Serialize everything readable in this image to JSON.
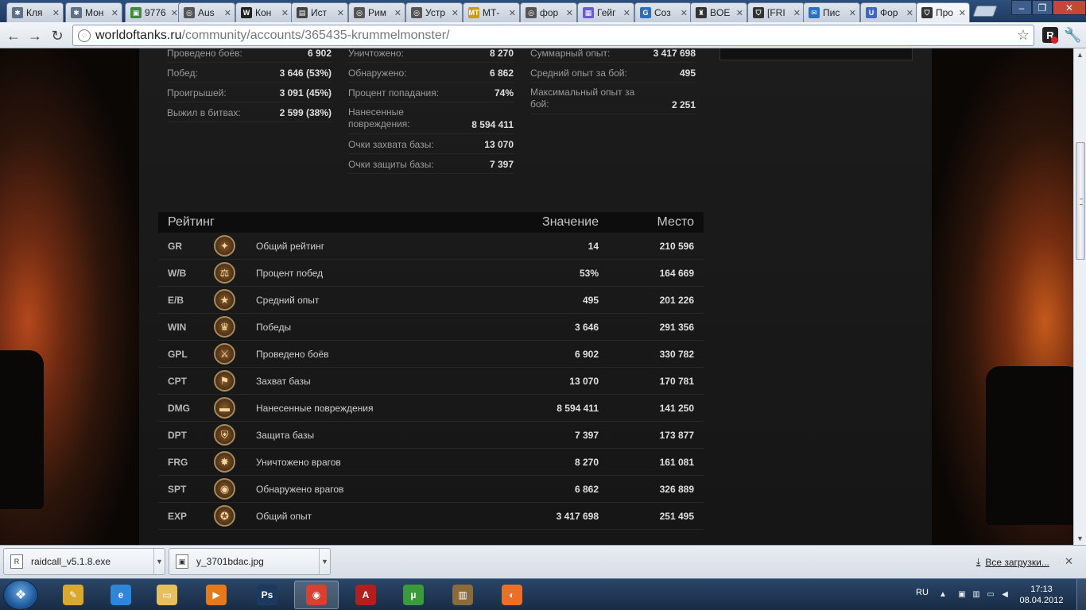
{
  "browser": {
    "tabs": [
      {
        "title": "Кля",
        "favicon": "puzzle-icon",
        "color": "#5f6f86",
        "glyph": "✱"
      },
      {
        "title": "Мон",
        "favicon": "puzzle-icon",
        "color": "#5f6f86",
        "glyph": "✱"
      },
      {
        "title": "9776",
        "favicon": "image-icon",
        "color": "#3e8a3e",
        "glyph": "▣"
      },
      {
        "title": "Aus",
        "favicon": "globe-icon",
        "color": "#555",
        "glyph": "◎"
      },
      {
        "title": "Кон",
        "favicon": "wikipedia-icon",
        "color": "#222",
        "glyph": "W"
      },
      {
        "title": "Ист",
        "favicon": "page-icon",
        "color": "#444",
        "glyph": "▤"
      },
      {
        "title": "Рим",
        "favicon": "globe-icon",
        "color": "#555",
        "glyph": "◎"
      },
      {
        "title": "Устр",
        "favicon": "globe-icon",
        "color": "#555",
        "glyph": "◎"
      },
      {
        "title": "МТ-",
        "favicon": "mt-icon",
        "color": "#c89b12",
        "glyph": "MT"
      },
      {
        "title": "фор",
        "favicon": "globe-icon",
        "color": "#555",
        "glyph": "◎"
      },
      {
        "title": "Гейг",
        "favicon": "calendar-icon",
        "color": "#6b5bd0",
        "glyph": "▦"
      },
      {
        "title": "Соз",
        "favicon": "blog-icon",
        "color": "#2a6fc4",
        "glyph": "G"
      },
      {
        "title": "BOE",
        "favicon": "tank-icon",
        "color": "#333",
        "glyph": "♜"
      },
      {
        "title": "[FRI",
        "favicon": "shield-icon",
        "color": "#333",
        "glyph": "⛉"
      },
      {
        "title": "Пис",
        "favicon": "mail-icon",
        "color": "#2a6fc4",
        "glyph": "✉"
      },
      {
        "title": "Фор",
        "favicon": "u-icon",
        "color": "#3f66c0",
        "glyph": "U"
      },
      {
        "title": "Про",
        "favicon": "wot-icon",
        "color": "#333",
        "glyph": "⛉",
        "active": true
      }
    ],
    "url_domain": "worldoftanks.ru",
    "url_path": "/community/accounts/365435-krummelmonster/",
    "window_buttons": {
      "minimize": "–",
      "maximize": "❐",
      "close": "✕"
    }
  },
  "stats": {
    "col1": [
      {
        "label": "Проведено боёв:",
        "value": "6 902"
      },
      {
        "label": "Побед:",
        "value": "3 646 (53%)"
      },
      {
        "label": "Проигрышей:",
        "value": "3 091 (45%)"
      },
      {
        "label": "Выжил в битвах:",
        "value": "2 599 (38%)"
      }
    ],
    "col2": [
      {
        "label": "Уничтожено:",
        "value": "8 270"
      },
      {
        "label": "Обнаружено:",
        "value": "6 862"
      },
      {
        "label": "Процент попадания:",
        "value": "74%"
      },
      {
        "label": "Нанесенные повреждения:",
        "value": "8 594 411"
      },
      {
        "label": "Очки захвата базы:",
        "value": "13 070"
      },
      {
        "label": "Очки защиты базы:",
        "value": "7 397"
      }
    ],
    "col3": [
      {
        "label": "Суммарный опыт:",
        "value": "3 417 698"
      },
      {
        "label": "Средний опыт за бой:",
        "value": "495"
      },
      {
        "label": "Максимальный опыт за бой:",
        "value": "2 251"
      }
    ]
  },
  "rating": {
    "header": {
      "title": "Рейтинг",
      "value": "Значение",
      "place": "Место"
    },
    "rows": [
      {
        "code": "GR",
        "icon": "eagle-icon",
        "glyph": "✦",
        "name": "Общий рейтинг",
        "value": "14",
        "place": "210 596"
      },
      {
        "code": "W/B",
        "icon": "scales-icon",
        "glyph": "⚖",
        "name": "Процент побед",
        "value": "53%",
        "place": "164 669"
      },
      {
        "code": "E/B",
        "icon": "star-icon",
        "glyph": "★",
        "name": "Средний опыт",
        "value": "495",
        "place": "201 226"
      },
      {
        "code": "WIN",
        "icon": "trophy-icon",
        "glyph": "♛",
        "name": "Победы",
        "value": "3 646",
        "place": "291 356"
      },
      {
        "code": "GPL",
        "icon": "crossed-swords-icon",
        "glyph": "⚔",
        "name": "Проведено боёв",
        "value": "6 902",
        "place": "330 782"
      },
      {
        "code": "CPT",
        "icon": "flag-icon",
        "glyph": "⚑",
        "name": "Захват базы",
        "value": "13 070",
        "place": "170 781"
      },
      {
        "code": "DMG",
        "icon": "tank-icon",
        "glyph": "▬",
        "name": "Нанесенные повреждения",
        "value": "8 594 411",
        "place": "141 250"
      },
      {
        "code": "DPT",
        "icon": "shield-icon",
        "glyph": "⛨",
        "name": "Защита базы",
        "value": "7 397",
        "place": "173 877"
      },
      {
        "code": "FRG",
        "icon": "explosion-icon",
        "glyph": "✸",
        "name": "Уничтожено врагов",
        "value": "8 270",
        "place": "161 081"
      },
      {
        "code": "SPT",
        "icon": "binoculars-icon",
        "glyph": "◉",
        "name": "Обнаружено врагов",
        "value": "6 862",
        "place": "326 889"
      },
      {
        "code": "EXP",
        "icon": "star-icon",
        "glyph": "✪",
        "name": "Общий опыт",
        "value": "3 417 698",
        "place": "251 495"
      }
    ]
  },
  "downloads": {
    "items": [
      {
        "name": "raidcall_v5.1.8.exe",
        "icon": "exe-file-icon",
        "glyph": "R"
      },
      {
        "name": "y_3701bdac.jpg",
        "icon": "image-file-icon",
        "glyph": "▣"
      }
    ],
    "show_all": "Все загрузки...",
    "close": "✕"
  },
  "taskbar": {
    "items": [
      {
        "name": "paint-icon",
        "glyph": "✎",
        "color": "#d9a82f"
      },
      {
        "name": "internet-explorer-icon",
        "glyph": "e",
        "color": "#2f86d6"
      },
      {
        "name": "folder-icon",
        "glyph": "▭",
        "color": "#e6c05a"
      },
      {
        "name": "media-player-icon",
        "glyph": "▶",
        "color": "#e57a1d"
      },
      {
        "name": "photoshop-icon",
        "glyph": "Ps",
        "color": "#1c3a5e"
      },
      {
        "name": "chrome-icon",
        "glyph": "◉",
        "color": "#d8402f",
        "active": true
      },
      {
        "name": "acrobat-icon",
        "glyph": "A",
        "color": "#b21f1f"
      },
      {
        "name": "utorrent-icon",
        "glyph": "µ",
        "color": "#3b9b3b"
      },
      {
        "name": "books-icon",
        "glyph": "▥",
        "color": "#8b6a3c"
      },
      {
        "name": "origin-icon",
        "glyph": "◐",
        "color": "#e8702a"
      }
    ],
    "language": "RU",
    "time": "17:13",
    "date": "08.04.2012"
  }
}
